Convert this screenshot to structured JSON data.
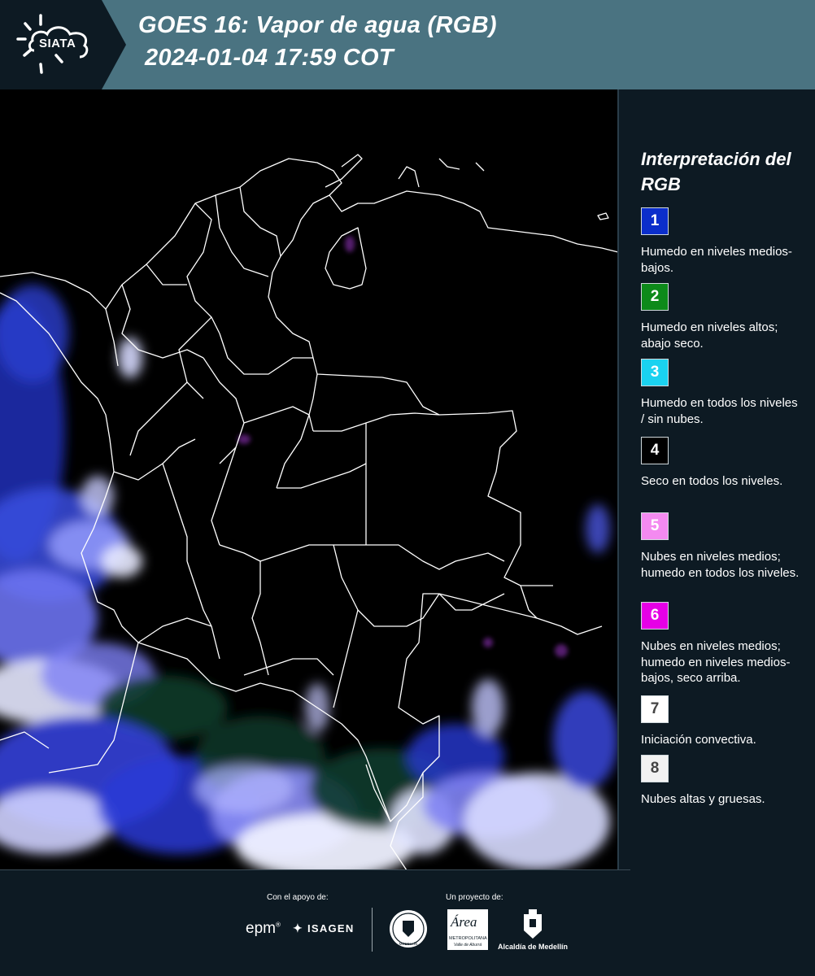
{
  "header": {
    "logo_text": "SIATA",
    "title_line1": "GOES 16: Vapor de agua (RGB)",
    "title_line2": "2024-01-04 17:59 COT",
    "background_color": "#4a7381",
    "logo_background_color": "#0d1a23"
  },
  "map": {
    "background_color": "#000000",
    "border_color": "#ffffff",
    "cloud_colors": [
      "#2a3bd6",
      "#8a8cf5",
      "#e6e8ff",
      "#0c3a2a",
      "#7a2c9e"
    ]
  },
  "legend": {
    "title": "Interpretación del RGB",
    "items": [
      {
        "number": "1",
        "text": "Humedo en niveles medios-bajos.",
        "color": "#0b2ecb",
        "number_color": "#ffffff"
      },
      {
        "number": "2",
        "text": "Humedo en niveles altos; abajo seco.",
        "color": "#0d8a1a",
        "number_color": "#ffffff"
      },
      {
        "number": "3",
        "text": "Humedo en todos los niveles / sin nubes.",
        "color": "#1ad2f0",
        "number_color": "#ffffff"
      },
      {
        "number": "4",
        "text": "Seco en todos los niveles.",
        "color": "#000000",
        "number_color": "#ffffff"
      },
      {
        "number": "5",
        "text": "Nubes en niveles medios; humedo en todos los niveles.",
        "color": "#f48af0",
        "number_color": "#ffffff"
      },
      {
        "number": "6",
        "text": "Nubes en niveles medios; humedo en niveles medios-bajos, seco arriba.",
        "color": "#e600e6",
        "number_color": "#ffffff"
      },
      {
        "number": "7",
        "text": "Iniciación convectiva.",
        "color": "#ffffff",
        "number_color": "#444444"
      },
      {
        "number": "8",
        "text": "Nubes altas y gruesas.",
        "color": "#f2f2f2",
        "number_color": "#444444"
      }
    ]
  },
  "footer": {
    "support_caption": "Con el apoyo de:",
    "project_caption": "Un proyecto de:",
    "partners": {
      "epm": "epm",
      "isagen": "ISAGEN",
      "area_main": "Área",
      "area_sub1": "METROPOLITANA",
      "area_sub2": "Valle de Aburrá",
      "alcaldia": "Alcaldía de Medellín",
      "seal_text": "MEDELLÍN"
    }
  }
}
